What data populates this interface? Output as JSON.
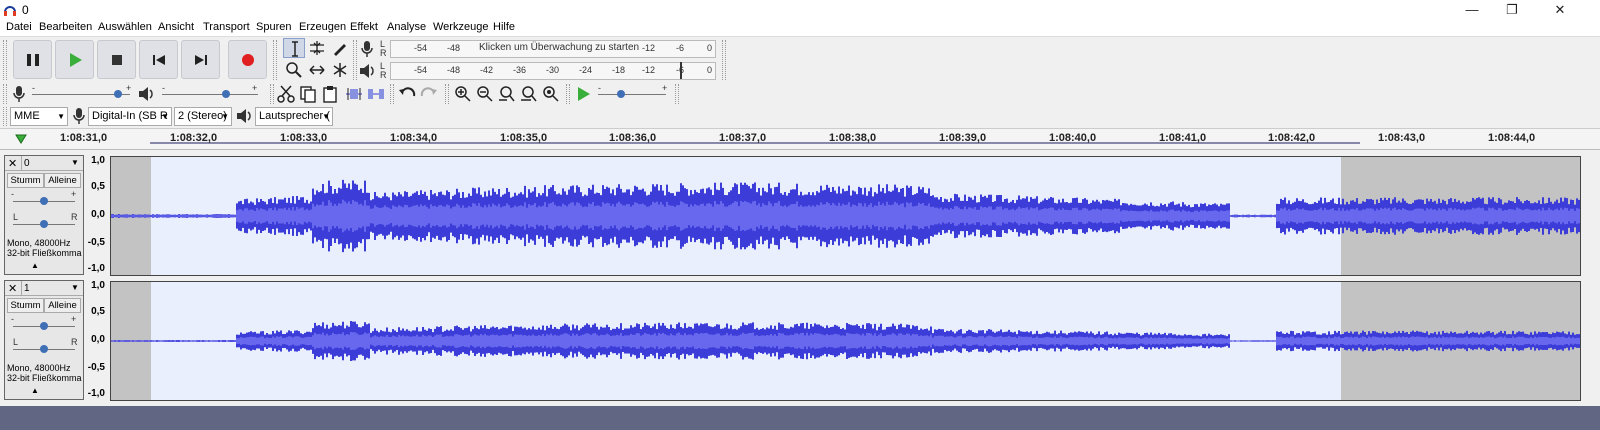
{
  "window": {
    "title": "0",
    "minimize": "—",
    "restore": "❐",
    "close": "✕"
  },
  "menu": [
    "Datei",
    "Bearbeiten",
    "Auswählen",
    "Ansicht",
    "Transport",
    "Spuren",
    "Erzeugen",
    "Effekt",
    "Analyse",
    "Werkzeuge",
    "Hilfe"
  ],
  "transport": [
    "pause-icon",
    "play-icon",
    "stop-icon",
    "skip-start-icon",
    "skip-end-icon",
    "record-icon"
  ],
  "recording_meter": {
    "L": "L",
    "R": "R",
    "ticks": [
      "-54",
      "-48",
      "-12",
      "-6",
      "0"
    ],
    "prompt": "Klicken um Überwachung zu starten"
  },
  "playback_meter": {
    "L": "L",
    "R": "R",
    "ticks": [
      "-54",
      "-48",
      "-42",
      "-36",
      "-30",
      "-24",
      "-18",
      "-12",
      "-6",
      "0"
    ]
  },
  "mixer": {
    "minus": "-",
    "plus": "+"
  },
  "devices": {
    "host": "MME",
    "input": "Digital-In (SB R",
    "channels": "2 (Stereo)",
    "output": "Lautsprecher ("
  },
  "ruler": [
    "1:08:31,0",
    "1:08:32,0",
    "1:08:33,0",
    "1:08:34,0",
    "1:08:35,0",
    "1:08:36,0",
    "1:08:37,0",
    "1:08:38,0",
    "1:08:39,0",
    "1:08:40,0",
    "1:08:41,0",
    "1:08:42,0",
    "1:08:43,0",
    "1:08:44,0"
  ],
  "scale_labels": [
    "1,0",
    "0,5",
    "0,0",
    "-0,5",
    "-1,0"
  ],
  "tracks": [
    {
      "name": "0",
      "mute": "Stumm",
      "solo": "Alleine",
      "gain_min": "-",
      "gain_max": "+",
      "pan_l": "L",
      "pan_r": "R",
      "rate": "Mono, 48000Hz",
      "format": "32-bit Fließkomma"
    },
    {
      "name": "1",
      "mute": "Stumm",
      "solo": "Alleine",
      "gain_min": "-",
      "gain_max": "+",
      "pan_l": "L",
      "pan_r": "R",
      "rate": "Mono, 48000Hz",
      "format": "32-bit Fließkomma"
    }
  ],
  "colors": {
    "waveform": "#3c3cd8",
    "wave_bg": "#e9effc",
    "selection_gray": "#c3c3c3",
    "bottom": "#616682"
  }
}
